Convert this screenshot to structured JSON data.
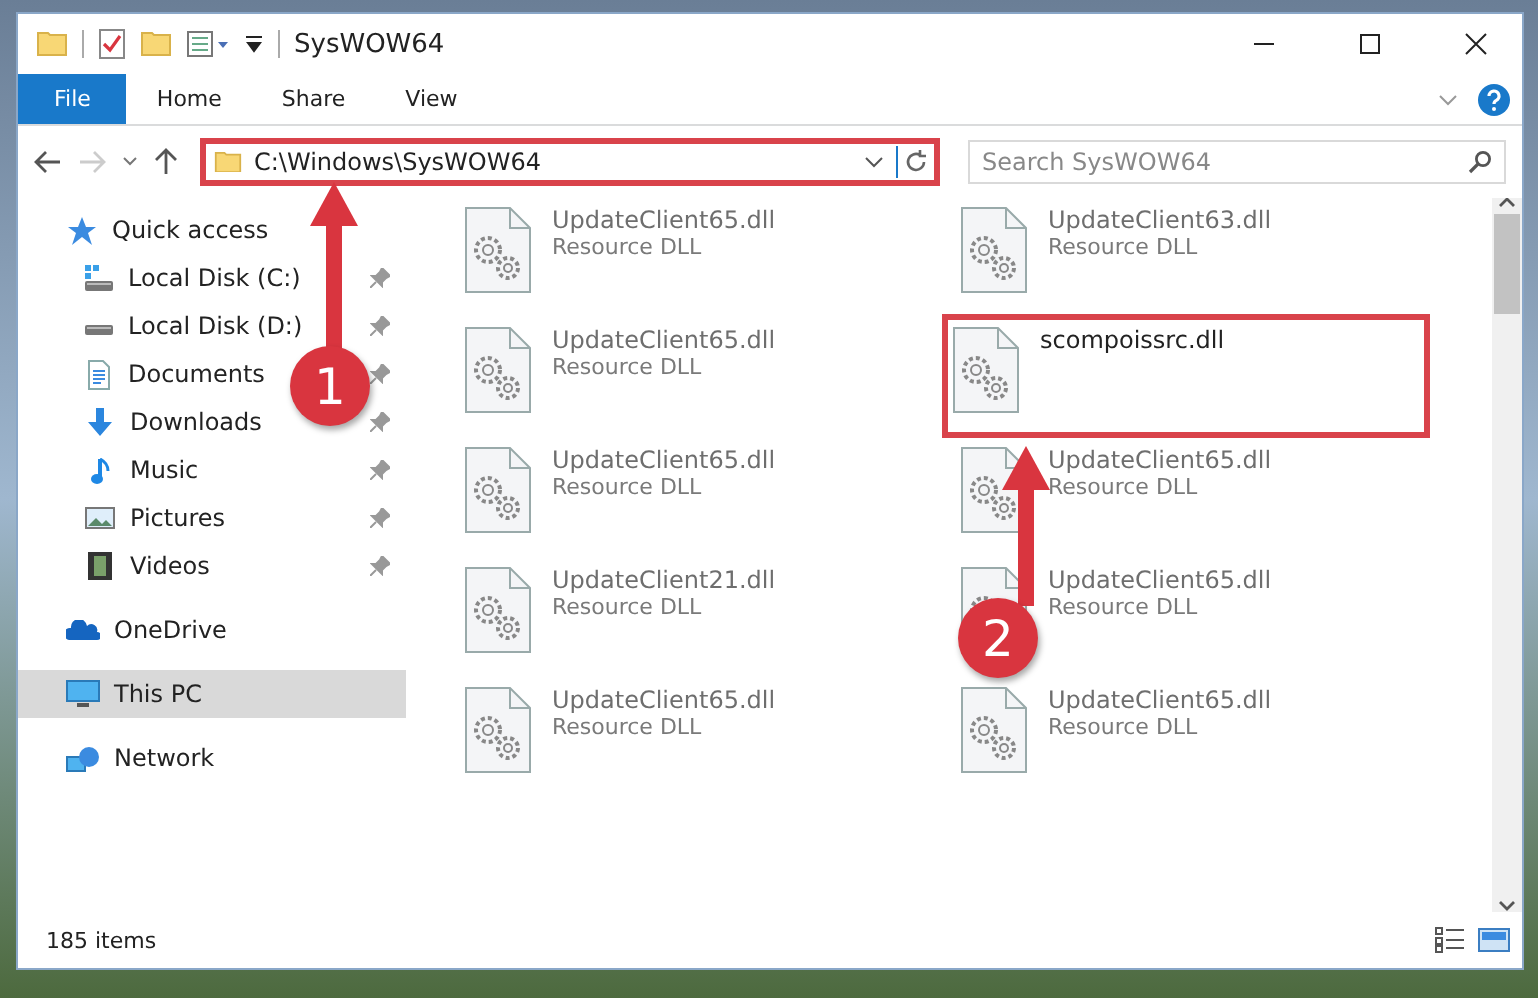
{
  "window": {
    "title": "SysWOW64"
  },
  "ribbon_tabs": [
    {
      "label": "File",
      "kind": "file"
    },
    {
      "label": "Home",
      "kind": "tab"
    },
    {
      "label": "Share",
      "kind": "tab"
    },
    {
      "label": "View",
      "kind": "tab"
    }
  ],
  "address": {
    "path": "C:\\Windows\\SysWOW64",
    "highlighted": true
  },
  "search": {
    "placeholder": "Search SysWOW64"
  },
  "sidebar": {
    "items": [
      {
        "label": "Quick access",
        "kind": "quick-access",
        "selected": false,
        "children": [
          {
            "label": "Local Disk (C:)",
            "kind": "system-drive",
            "pinned": true
          },
          {
            "label": "Local Disk (D:)",
            "kind": "drive",
            "pinned": true
          },
          {
            "label": "Documents",
            "kind": "documents",
            "pinned": true
          },
          {
            "label": "Downloads",
            "kind": "downloads",
            "pinned": true
          },
          {
            "label": "Music",
            "kind": "music",
            "pinned": true
          },
          {
            "label": "Pictures",
            "kind": "pictures",
            "pinned": true
          },
          {
            "label": "Videos",
            "kind": "videos",
            "pinned": true
          }
        ]
      },
      {
        "label": "OneDrive",
        "kind": "cloud",
        "selected": false
      },
      {
        "label": "This PC",
        "kind": "computer",
        "selected": true
      },
      {
        "label": "Network",
        "kind": "network",
        "selected": false
      }
    ]
  },
  "files": [
    {
      "name": "UpdateClient65.dll",
      "type": "Resource DLL",
      "blurred": true,
      "highlighted": false
    },
    {
      "name": "UpdateClient63.dll",
      "type": "Resource DLL",
      "blurred": true,
      "highlighted": false
    },
    {
      "name": "UpdateClient65.dll",
      "type": "Resource DLL",
      "blurred": true,
      "highlighted": false
    },
    {
      "name": "scompoissrc.dll",
      "blurred": false,
      "highlighted": true
    },
    {
      "name": "UpdateClient65.dll",
      "type": "Resource DLL",
      "blurred": true,
      "highlighted": false
    },
    {
      "name": "UpdateClient65.dll",
      "type": "Resource DLL",
      "blurred": true,
      "highlighted": false
    },
    {
      "name": "UpdateClient21.dll",
      "type": "Resource DLL",
      "blurred": true,
      "highlighted": false
    },
    {
      "name": "UpdateClient65.dll",
      "type": "Resource DLL",
      "blurred": true,
      "highlighted": false
    },
    {
      "name": "UpdateClient65.dll",
      "type": "Resource DLL",
      "blurred": true,
      "highlighted": false
    },
    {
      "name": "UpdateClient65.dll",
      "type": "Resource DLL",
      "blurred": true,
      "highlighted": false
    }
  ],
  "annotations": [
    {
      "label": "1"
    },
    {
      "label": "2"
    }
  ],
  "status_bar": {
    "item_count": "185 items"
  }
}
